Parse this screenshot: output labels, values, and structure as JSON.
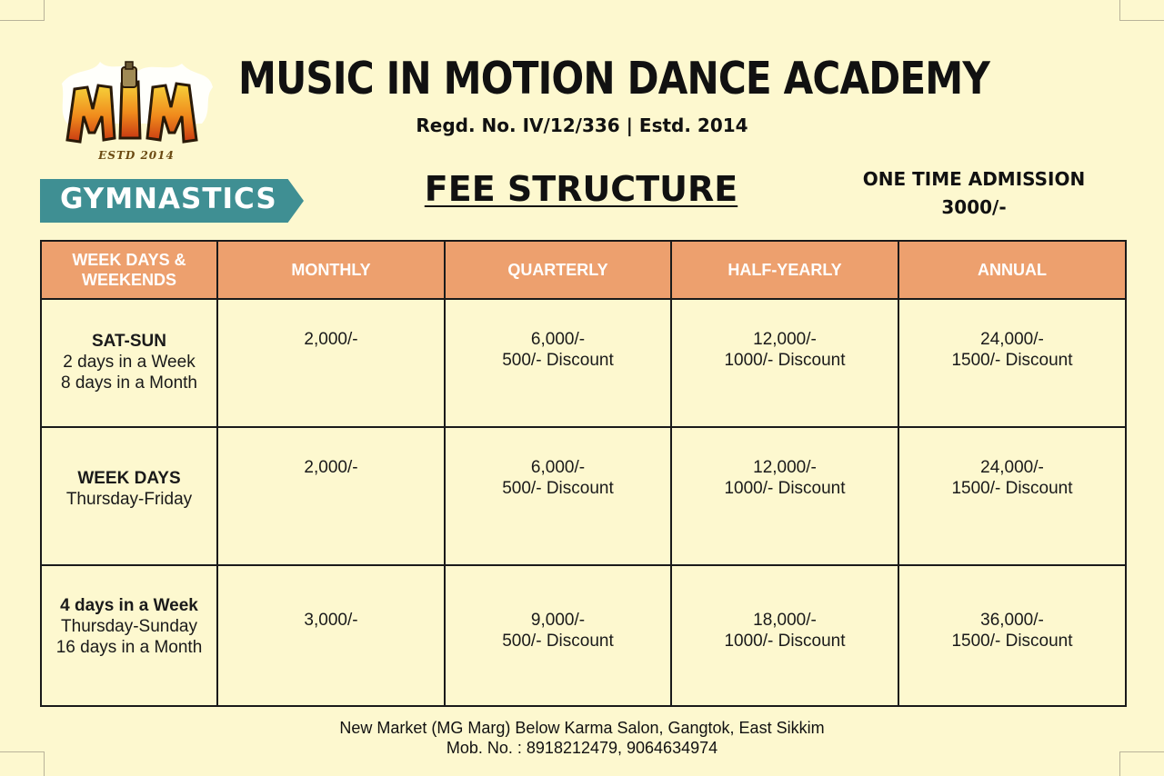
{
  "logo": {
    "sub_text": "ESTD 2014",
    "icon": "mim-graffiti-logo"
  },
  "header": {
    "title": "MUSIC IN MOTION DANCE ACADEMY",
    "regd": "Regd. No. IV/12/336 | Estd. 2014"
  },
  "tag": {
    "label": "GYMNASTICS",
    "color": "#3f8f93"
  },
  "fee_title": "FEE STRUCTURE",
  "admission": {
    "label": "ONE TIME ADMISSION",
    "amount": "3000/-"
  },
  "table": {
    "header_color": "#eda06e",
    "headers": [
      "WEEK DAYS & WEEKENDS",
      "MONTHLY",
      "QUARTERLY",
      "HALF-YEARLY",
      "ANNUAL"
    ],
    "rows": [
      {
        "plan": {
          "name": "SAT-SUN",
          "lines": [
            "2 days in a Week",
            "8 days in a Month"
          ]
        },
        "monthly": {
          "price": "2,000/-"
        },
        "quarterly": {
          "price": "6,000/-",
          "discount": "500/- Discount"
        },
        "half_yearly": {
          "price": "12,000/-",
          "discount": "1000/- Discount"
        },
        "annual": {
          "price": "24,000/-",
          "discount": "1500/- Discount"
        }
      },
      {
        "plan": {
          "name": "WEEK DAYS",
          "lines": [
            "Thursday-Friday"
          ]
        },
        "monthly": {
          "price": "2,000/-"
        },
        "quarterly": {
          "price": "6,000/-",
          "discount": "500/- Discount"
        },
        "half_yearly": {
          "price": "12,000/-",
          "discount": "1000/- Discount"
        },
        "annual": {
          "price": "24,000/-",
          "discount": "1500/- Discount"
        }
      },
      {
        "plan": {
          "name": "4 days in a Week",
          "lines": [
            "Thursday-Sunday",
            "16 days in a Month"
          ]
        },
        "monthly": {
          "price": "3,000/-"
        },
        "quarterly": {
          "price": "9,000/-",
          "discount": "500/- Discount"
        },
        "half_yearly": {
          "price": "18,000/-",
          "discount": "1000/- Discount"
        },
        "annual": {
          "price": "36,000/-",
          "discount": "1500/- Discount"
        }
      }
    ]
  },
  "footer": {
    "address": "New Market (MG Marg) Below Karma Salon, Gangtok, East Sikkim",
    "phone": "Mob. No. : 8918212479, 9064634974"
  }
}
